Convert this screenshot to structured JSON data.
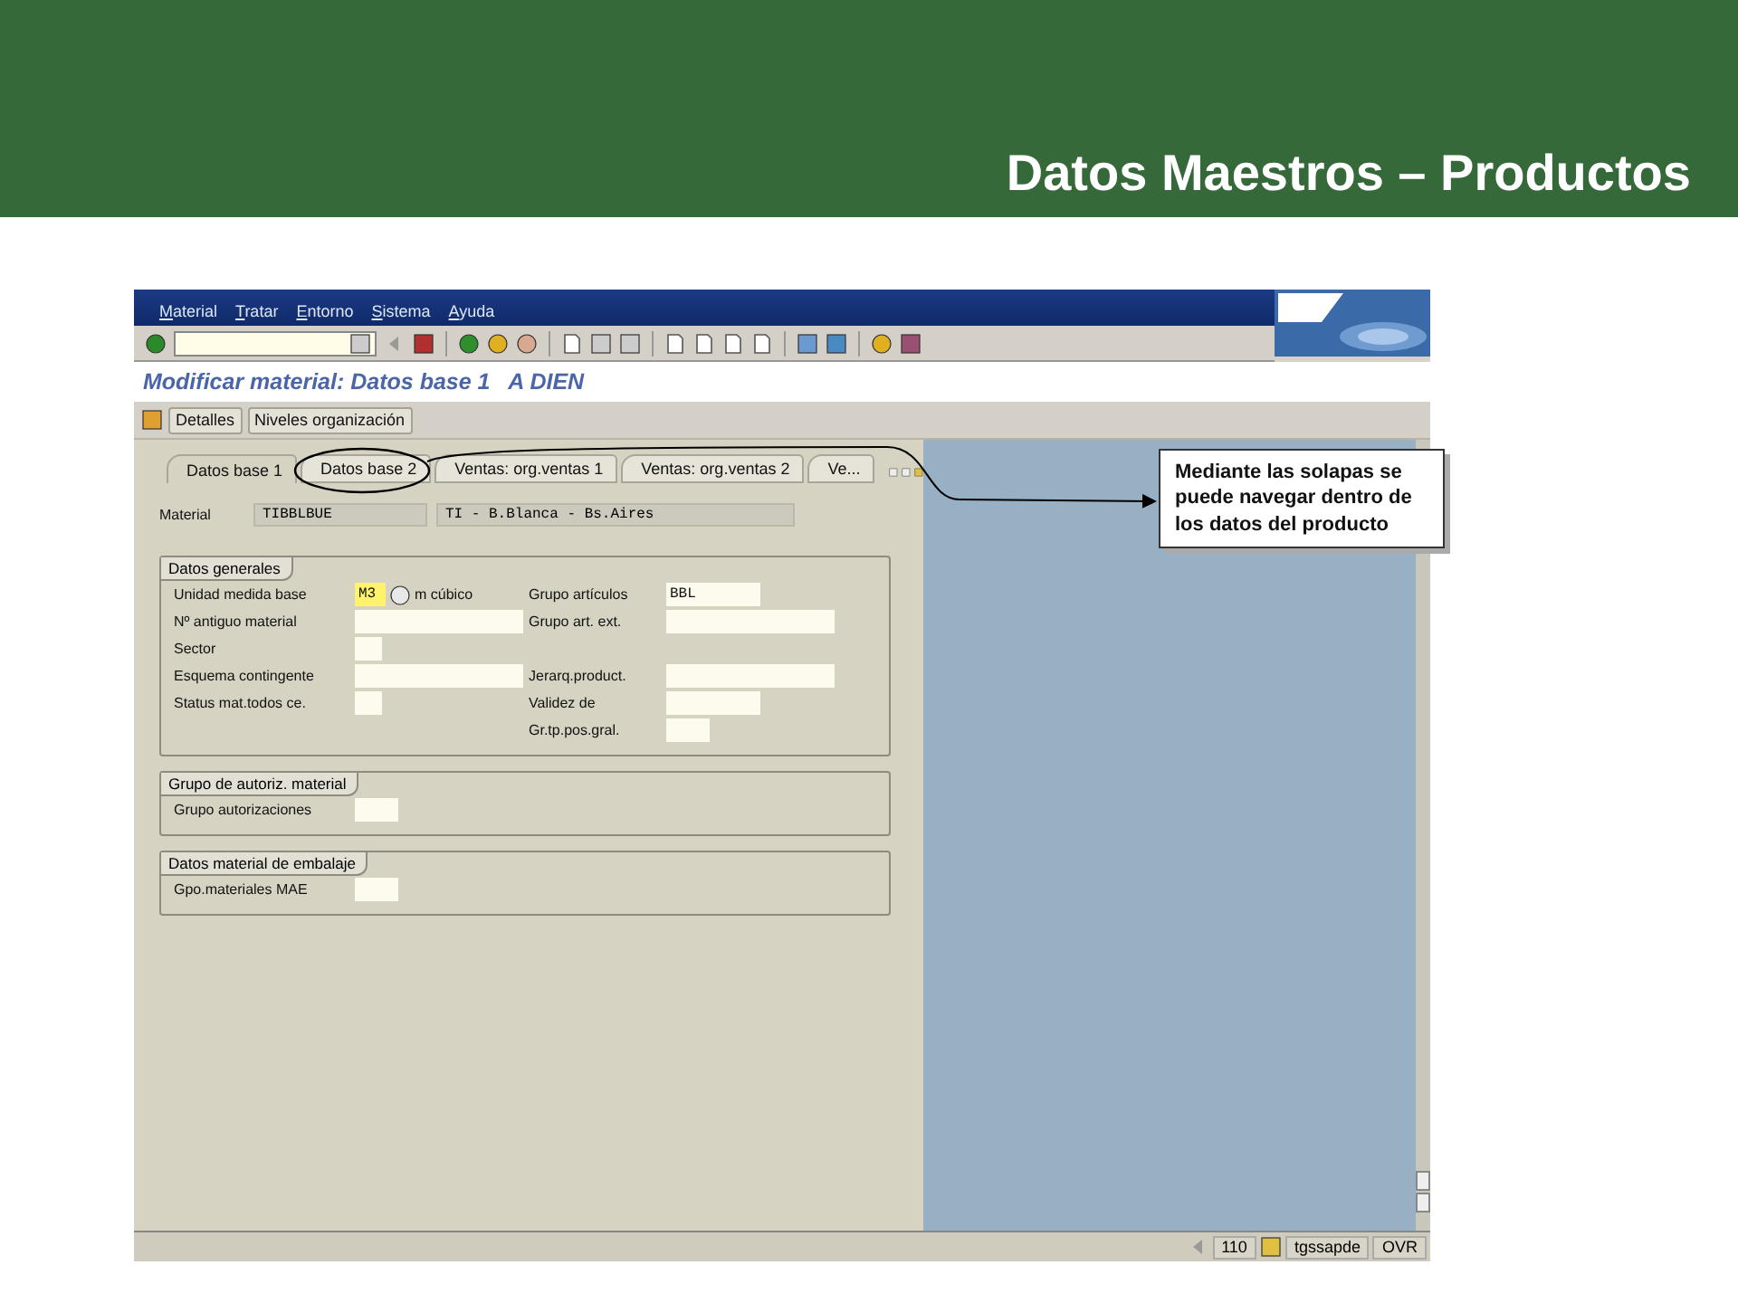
{
  "slide": {
    "title": "Datos Maestros – Productos"
  },
  "sap": {
    "menu": [
      "Material",
      "Tratar",
      "Entorno",
      "Sistema",
      "Ayuda"
    ],
    "screen_title": "Modificar material: Datos base 1   A DIEN",
    "app_buttons": [
      "Detalles",
      "Niveles organización"
    ],
    "tabs": [
      {
        "label": "Datos base 1",
        "selected": true
      },
      {
        "label": "Datos base 2",
        "selected": false
      },
      {
        "label": "Ventas: org.ventas 1",
        "selected": false
      },
      {
        "label": "Ventas: org.ventas 2",
        "selected": false
      },
      {
        "label": "Ve...",
        "selected": false
      }
    ],
    "material": {
      "label": "Material",
      "code": "TIBBLBUE",
      "description": "TI - B.Blanca - Bs.Aires"
    },
    "groups": [
      {
        "title": "Datos generales",
        "rows": [
          {
            "left": {
              "label": "Unidad medida base",
              "field": {
                "kind": "short",
                "value": "M3",
                "focused": true,
                "value_help": true
              },
              "unit": "m cúbico"
            },
            "right": {
              "label": "Grupo artículos",
              "field": {
                "kind": "medium",
                "value": "BBL",
                "focused": false
              }
            }
          },
          {
            "left": {
              "label": "Nº antiguo material",
              "field": {
                "kind": "long",
                "focused": false
              }
            },
            "right": {
              "label": "Grupo art. ext.",
              "field": {
                "kind": "long",
                "focused": false
              }
            }
          },
          {
            "left": {
              "label": "Sector",
              "field": {
                "kind": "tiny",
                "focused": false
              }
            }
          },
          {
            "left": {
              "label": "Esquema contingente",
              "field": {
                "kind": "long",
                "focused": false
              }
            },
            "right": {
              "label": "Jerarq.product.",
              "field": {
                "kind": "long",
                "focused": false
              }
            }
          },
          {
            "left": {
              "label": "Status mat.todos ce.",
              "field": {
                "kind": "tiny",
                "focused": false
              }
            },
            "right": {
              "label": "Validez de",
              "field": {
                "kind": "medium",
                "focused": false
              }
            }
          },
          {
            "right": {
              "label": "Gr.tp.pos.gral.",
              "field": {
                "kind": "small",
                "focused": false
              }
            }
          }
        ]
      },
      {
        "title": "Grupo de autoriz. material",
        "rows": [
          {
            "left": {
              "label": "Grupo autorizaciones",
              "field": {
                "kind": "small",
                "focused": false
              }
            }
          }
        ]
      },
      {
        "title": "Datos material de embalaje",
        "rows": [
          {
            "left": {
              "label": "Gpo.materiales MAE",
              "field": {
                "kind": "small",
                "focused": false
              }
            }
          }
        ]
      }
    ],
    "status_bar": {
      "session": "110",
      "server": "tgssapde",
      "mode": "OVR"
    }
  },
  "callout": {
    "text": "Mediante las solapas se puede navegar dentro de los datos del producto"
  }
}
